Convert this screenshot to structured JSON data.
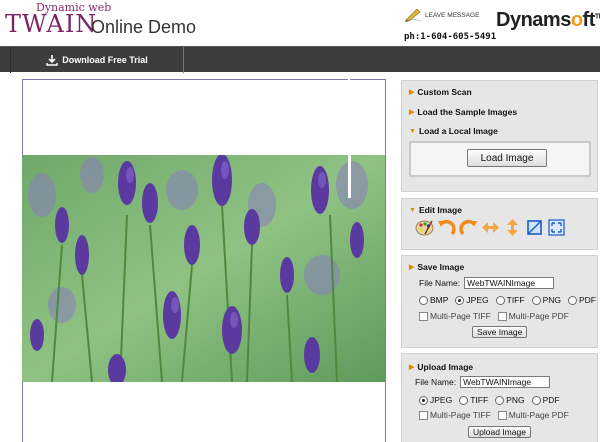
{
  "header": {
    "logo_small": "Dynamic web",
    "logo_big": "TWAIN",
    "logo_sub": "Online Demo",
    "leave_message": "LEAVE MESSAGE",
    "brand_part1": "Dynams",
    "brand_o": "o",
    "brand_part2": "ft",
    "brand_tm": "TM",
    "phone": "ph:1-604-605-5491"
  },
  "toolbar": {
    "download_label": "Download Free Trial"
  },
  "panel_scan": {
    "custom_scan": "Custom Scan",
    "load_sample": "Load the Sample Images",
    "load_local": "Load a Local Image",
    "load_button": "Load Image"
  },
  "panel_edit": {
    "title": "Edit Image",
    "tools": [
      "palette-icon",
      "rotate-left-icon",
      "rotate-right-icon",
      "flip-horizontal-icon",
      "flip-vertical-icon",
      "crop-icon",
      "resize-icon"
    ]
  },
  "panel_save": {
    "title": "Save Image",
    "file_name_label": "File Name:",
    "file_name_value": "WebTWAINImage",
    "formats": [
      "BMP",
      "JPEG",
      "TIFF",
      "PNG",
      "PDF"
    ],
    "selected_format": "JPEG",
    "multi_tiff": "Multi-Page TIFF",
    "multi_pdf": "Multi-Page PDF",
    "save_button": "Save Image"
  },
  "panel_upload": {
    "title": "Upload Image",
    "file_name_label": "File Name:",
    "file_name_value": "WebTWAINImage",
    "formats": [
      "JPEG",
      "TIFF",
      "PNG",
      "PDF"
    ],
    "selected_format": "JPEG",
    "multi_tiff": "Multi-Page TIFF",
    "multi_pdf": "Multi-Page PDF",
    "upload_button": "Upload Image"
  },
  "colors": {
    "toolbar_bg": "#3c3c3c",
    "panel_bg": "#e6e6e6",
    "accent_orange": "#e08a00",
    "logo_purple": "#7a2465"
  }
}
